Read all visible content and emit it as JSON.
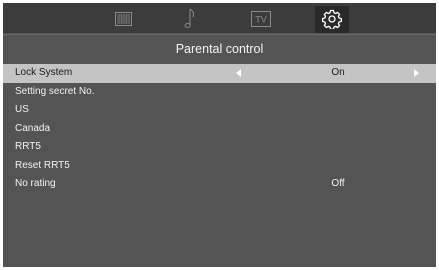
{
  "tabs": [
    {
      "icon": "picture-grid-icon"
    },
    {
      "icon": "music-note-icon"
    },
    {
      "icon": "tv-icon",
      "label": "TV"
    },
    {
      "icon": "gear-icon",
      "active": true
    }
  ],
  "page": {
    "title": "Parental control"
  },
  "menu": {
    "items": [
      {
        "label": "Lock System",
        "value": "On",
        "selected": true
      },
      {
        "label": "Setting secret No.",
        "value": ""
      },
      {
        "label": "US",
        "value": ""
      },
      {
        "label": "Canada",
        "value": ""
      },
      {
        "label": "RRT5",
        "value": ""
      },
      {
        "label": "Reset RRT5",
        "value": ""
      },
      {
        "label": "No rating",
        "value": "Off"
      }
    ]
  },
  "colors": {
    "background": "#545454",
    "topbar": "#3c3c3c",
    "selected_row": "#c4c4c4",
    "text": "#f2f2f2"
  }
}
